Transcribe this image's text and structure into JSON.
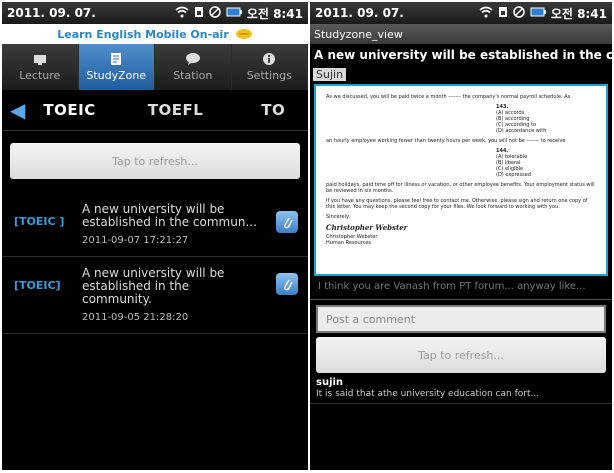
{
  "left": {
    "status": {
      "date": "2011. 09. 07.",
      "time": "오전 8:41"
    },
    "app_title": "Learn English Mobile On-air",
    "tabs": [
      {
        "label": "Lecture",
        "icon": "lecture-icon",
        "active": false
      },
      {
        "label": "StudyZone",
        "icon": "document-icon",
        "active": true
      },
      {
        "label": "Station",
        "icon": "chat-icon",
        "active": false
      },
      {
        "label": "Settings",
        "icon": "info-icon",
        "active": false
      }
    ],
    "categories": [
      "TOEIC",
      "TOEFL",
      "TO"
    ],
    "refresh_label": "Tap to refresh...",
    "posts": [
      {
        "tag": "[TOEIC ]",
        "title": "A new university will be established in the commun...",
        "date": "2011-09-07 17:21:27"
      },
      {
        "tag": "[TOEIC]",
        "title": "A new university will be established in the community.",
        "date": "2011-09-05 21:28:20"
      }
    ]
  },
  "right": {
    "status": {
      "date": "2011. 09. 07.",
      "time": "오전 8:41"
    },
    "screen_title": "Studyzone_view",
    "post_title": "A new university will be established in the commun...",
    "author": "Sujin",
    "doc": {
      "p1": "As we discussed, you will be paid twice a month ------- the company's normal payroll schedule. As",
      "q1_number": "143.",
      "q1_options": [
        "(A) accords",
        "(B) according",
        "(C) according to",
        "(D) accordance with"
      ],
      "p2": "an hourly employee working fewer than twenty hours per week, you will not be ------- to receive",
      "q2_number": "144.",
      "q2_options": [
        "(A) tolerable",
        "(B) liberal",
        "(C) eligible",
        "(D) expressed"
      ],
      "p3": "paid holidays, paid time off for illness or vacation, or other employee benefits. Your employment status will be reviewed in six months.",
      "p4": "If you have any questions, please feel free to contact me. Otherwise, please sign and return one copy of this letter. You may keep the second copy for your files. We look forward to working with you.",
      "closing": "Sincerely,",
      "signature": "Christopher Webster",
      "name": "Christopher Webster",
      "dept": "Human Resources"
    },
    "hint": "I think you are Vanash from PT forum... anyway like...",
    "comment_placeholder": "Post a comment",
    "refresh_label": "Tap to refresh...",
    "comments": [
      {
        "author": "sujin",
        "text": "It is said that athe university education can fort..."
      }
    ]
  }
}
